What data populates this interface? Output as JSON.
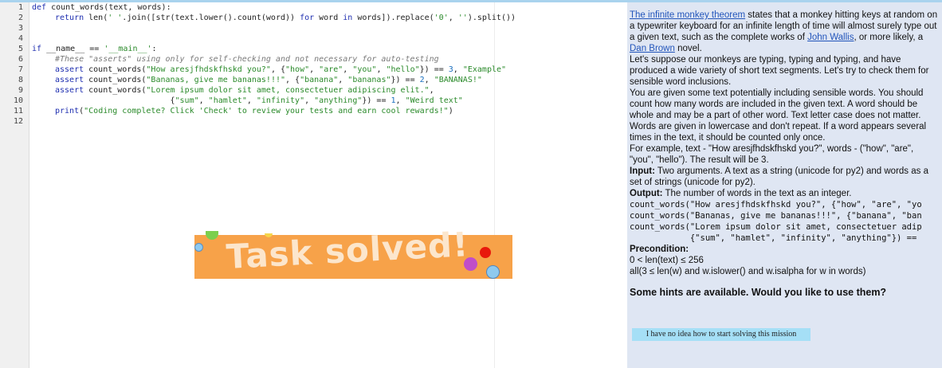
{
  "editor": {
    "line_numbers": [
      "1",
      "2",
      "3",
      "4",
      "5",
      "6",
      "7",
      "8",
      "9",
      "10",
      "11",
      "12"
    ],
    "code": {
      "l1_def": "def",
      "l1_rest": " count_words(text, words):",
      "l2_return": "return",
      "l2_a": " len(",
      "l2_s1": "' '",
      "l2_b": ".join([str(text.lower().count(word)) ",
      "l2_for": "for",
      "l2_c": " word ",
      "l2_in": "in",
      "l2_d": " words]).replace(",
      "l2_s2": "'0'",
      "l2_e": ", ",
      "l2_s3": "''",
      "l2_f": ").split())",
      "l5_if": "if",
      "l5_a": " __name__ == ",
      "l5_s": "'__main__'",
      "l5_b": ":",
      "l6_comment": "#These \"asserts\" using only for self-checking and not necessary for auto-testing",
      "l7_assert": "assert",
      "l7_a": " count_words(",
      "l7_s1": "\"How aresjfhdskfhskd you?\"",
      "l7_b": ", {",
      "l7_s2": "\"how\"",
      "l7_c": ", ",
      "l7_s3": "\"are\"",
      "l7_d": ", ",
      "l7_s4": "\"you\"",
      "l7_e": ", ",
      "l7_s5": "\"hello\"",
      "l7_f": "}) == ",
      "l7_n": "3",
      "l7_g": ", ",
      "l7_s6": "\"Example\"",
      "l8_assert": "assert",
      "l8_a": " count_words(",
      "l8_s1": "\"Bananas, give me bananas!!!\"",
      "l8_b": ", {",
      "l8_s2": "\"banana\"",
      "l8_c": ", ",
      "l8_s3": "\"bananas\"",
      "l8_d": "}) == ",
      "l8_n": "2",
      "l8_e": ", ",
      "l8_s4": "\"BANANAS!\"",
      "l9_assert": "assert",
      "l9_a": " count_words(",
      "l9_s1": "\"Lorem ipsum dolor sit amet, consectetuer adipiscing elit.\"",
      "l9_b": ",",
      "l10_pad": "                        {",
      "l10_s1": "\"sum\"",
      "l10_a": ", ",
      "l10_s2": "\"hamlet\"",
      "l10_b": ", ",
      "l10_s3": "\"infinity\"",
      "l10_c": ", ",
      "l10_s4": "\"anything\"",
      "l10_d": "}) == ",
      "l10_n": "1",
      "l10_e": ", ",
      "l10_s5": "\"Weird text\"",
      "l11_print": "print",
      "l11_a": "(",
      "l11_s": "\"Coding complete? Click 'Check' to review your tests and earn cool rewards!\"",
      "l11_b": ")"
    }
  },
  "banner": {
    "text": "Task solved!"
  },
  "panel": {
    "p1_link1": "The infinite monkey theorem",
    "p1_a": " states that a monkey hitting keys at random on a typewriter keyboard for an infinite length of time will almost surely type out a given text, such as the complete works of ",
    "p1_link2": "John Wallis",
    "p1_b": ", or more likely, a ",
    "p1_link3": "Dan Brown",
    "p1_c": " novel.",
    "p2": "Let's suppose our monkeys are typing, typing and typing, and have produced a wide variety of short text segments. Let's try to check them for sensible word inclusions.",
    "p3": "You are given some text potentially including sensible words. You should count how many words are included in the given text. A word should be whole and may be a part of other word. Text letter case does not matter. Words are given in lowercase and don't repeat. If a word appears several times in the text, it should be counted only once.",
    "p4": "For example, text - \"How aresjfhdskfhskd you?\", words - (\"how\", \"are\", \"you\", \"hello\"). The result will be 3.",
    "input_label": "Input:",
    "input_text": " Two arguments. A text as a string (unicode for py2) and words as a set of strings (unicode for py2).",
    "output_label": "Output:",
    "output_text": " The number of words in the text as an integer.",
    "ex1": "count_words(\"How aresjfhdskfhskd you?\", {\"how\", \"are\", \"yo",
    "ex2": "count_words(\"Bananas, give me bananas!!!\", {\"banana\", \"ban",
    "ex3": "count_words(\"Lorem ipsum dolor sit amet, consectetuer adip",
    "ex4": "            {\"sum\", \"hamlet\", \"infinity\", \"anything\"}) ==",
    "precondition_label": "Precondition:",
    "pre1": "0 < len(text) ≤ 256",
    "pre2": "all(3 ≤ len(w) and w.islower() and w.isalpha for w in words)",
    "hints_question": "Some hints are available. Would you like to use them?",
    "hint_button": "I have no idea how to start solving this mission"
  }
}
